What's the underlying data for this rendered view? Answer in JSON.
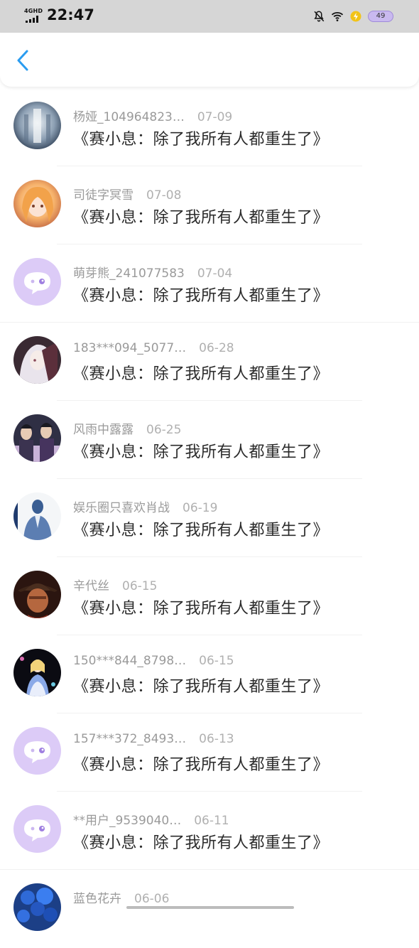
{
  "status_bar": {
    "network": "4GHD",
    "time": "22:47",
    "battery": "49",
    "icons": [
      "signal-bars-icon",
      "notification-off-icon",
      "wifi-icon",
      "charging-icon",
      "battery-icon"
    ]
  },
  "header": {
    "back_icon": "chevron-left-icon",
    "accent": "#2a9cf0"
  },
  "comments": [
    {
      "user": "杨娅_104964823…",
      "date": "07-09",
      "text": "《赛小息：除了我所有人都重生了》",
      "avatar": "photo-avatar"
    },
    {
      "user": "司徒字冥雪",
      "date": "07-08",
      "text": "《赛小息：除了我所有人都重生了》",
      "avatar": "anime-girl-avatar"
    },
    {
      "user": "萌芽熊_241077583",
      "date": "07-04",
      "text": "《赛小息：除了我所有人都重生了》",
      "avatar": "default-chat-avatar"
    },
    {
      "user": "183***094_5077…",
      "date": "06-28",
      "text": "《赛小息：除了我所有人都重生了》",
      "avatar": "anime-avatar"
    },
    {
      "user": "风雨中露露",
      "date": "06-25",
      "text": "《赛小息：除了我所有人都重生了》",
      "avatar": "group-avatar"
    },
    {
      "user": "娱乐圈只喜欢肖战",
      "date": "06-19",
      "text": "《赛小息：除了我所有人都重生了》",
      "avatar": "person-avatar"
    },
    {
      "user": "辛代丝",
      "date": "06-15",
      "text": "《赛小息：除了我所有人都重生了》",
      "avatar": "hat-man-avatar"
    },
    {
      "user": "150***844_8798…",
      "date": "06-15",
      "text": "《赛小息：除了我所有人都重生了》",
      "avatar": "alice-avatar"
    },
    {
      "user": "157***372_8493…",
      "date": "06-13",
      "text": "《赛小息：除了我所有人都重生了》",
      "avatar": "default-chat-avatar"
    },
    {
      "user": "**用户_9539040…",
      "date": "06-11",
      "text": "《赛小息：除了我所有人都重生了》",
      "avatar": "default-chat-avatar"
    },
    {
      "user": "蓝色花卉",
      "date": "06-06",
      "text": "",
      "avatar": "blue-flower-avatar"
    }
  ]
}
